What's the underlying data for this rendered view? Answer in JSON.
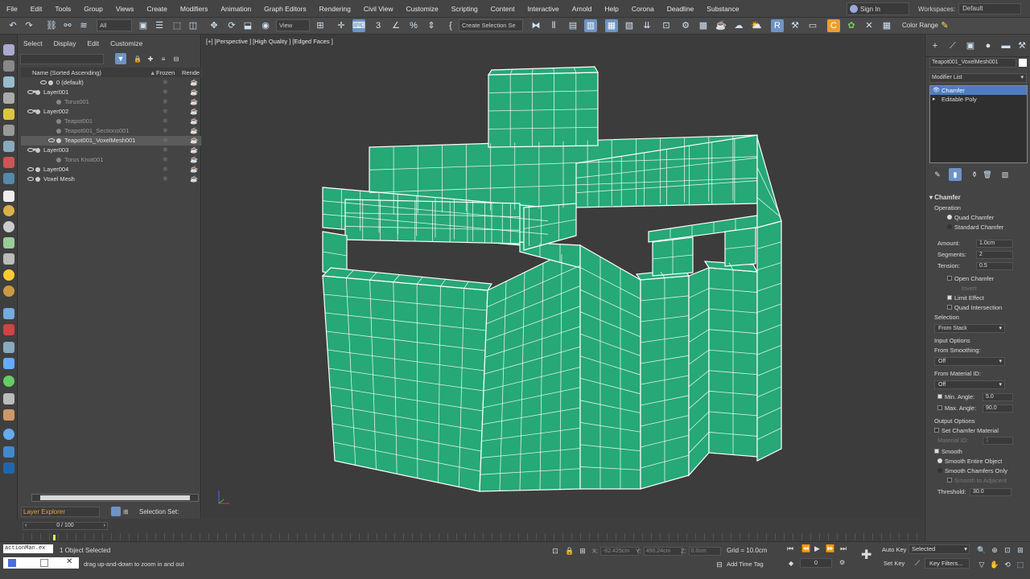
{
  "menu": [
    "File",
    "Edit",
    "Tools",
    "Group",
    "Views",
    "Create",
    "Modifiers",
    "Animation",
    "Graph Editors",
    "Rendering",
    "Civil View",
    "Customize",
    "Scripting",
    "Content",
    "Interactive",
    "Arnold",
    "Help",
    "Corona",
    "Deadline",
    "Substance"
  ],
  "sign_in": "Sign In",
  "workspace_label": "Workspaces:",
  "workspace_value": "Default",
  "toolbar": {
    "filter_value": "All",
    "ref_coord": "View",
    "selection_set": "Create Selection Se",
    "color_range": "Color Range"
  },
  "scene_explorer": {
    "tabs": [
      "Select",
      "Display",
      "Edit",
      "Customize"
    ],
    "col_name": "Name (Sorted Ascending)",
    "col_frozen": "Frozen",
    "col_render": "Rende",
    "rows": [
      {
        "label": "0 (default)",
        "dim": false,
        "sel": false
      },
      {
        "label": "Layer001",
        "dim": false,
        "sel": false
      },
      {
        "label": "Torus001",
        "dim": true,
        "sel": false
      },
      {
        "label": "Layer002",
        "dim": false,
        "sel": false
      },
      {
        "label": "Teapot001",
        "dim": true,
        "sel": false
      },
      {
        "label": "Teapot001_Sections001",
        "dim": true,
        "sel": false
      },
      {
        "label": "Teapot001_VoxelMesh001",
        "dim": false,
        "sel": true
      },
      {
        "label": "Layer003",
        "dim": false,
        "sel": false
      },
      {
        "label": "Torus Knot001",
        "dim": true,
        "sel": false
      },
      {
        "label": "Layer004",
        "dim": false,
        "sel": false
      },
      {
        "label": "Voxel Mesh",
        "dim": false,
        "sel": false
      }
    ],
    "bottom_title": "Layer Explorer",
    "selection_set_label": "Selection Set:"
  },
  "viewport": {
    "label": "[+] [Perspective ] [High Quality ] [Edged Faces ]",
    "mesh_color": "#26a877",
    "wire_color": "#ffffff"
  },
  "command_panel": {
    "object_name": "Teapot001_VoxelMesh001",
    "modifier_list": "Modifier List",
    "stack": [
      "Chamfer",
      "Editable Poly"
    ],
    "rollout_title": "Chamfer",
    "operation_label": "Operation",
    "quad_chamfer": "Quad Chamfer",
    "standard_chamfer": "Standard Chamfer",
    "amount_label": "Amount:",
    "amount_value": "1.0cm",
    "segments_label": "Segments:",
    "segments_value": "2",
    "tension_label": "Tension:",
    "tension_value": "0.5",
    "open_chamfer": "Open Chamfer",
    "invert": "Invert",
    "limit_effect": "Limit Effect",
    "quad_intersection": "Quad Intersection",
    "selection_label": "Selection",
    "selection_value": "From Stack",
    "input_options": "Input Options",
    "from_smoothing": "From Smoothing:",
    "from_smoothing_value": "Off",
    "from_material": "From Material ID:",
    "from_material_value": "Off",
    "min_angle_label": "Min. Angle:",
    "min_angle_value": "5.0",
    "max_angle_label": "Max. Angle:",
    "max_angle_value": "90.0",
    "output_options": "Output Options",
    "set_chamfer_material": "Set Chamfer Material",
    "material_id": "Material ID:",
    "material_id_value": "1",
    "smooth": "Smooth",
    "smooth_entire": "Smooth Entire Object",
    "smooth_chamfers": "Smooth Chamfers Only",
    "smooth_adjacent": "Smooth to Adjacent",
    "threshold_label": "Threshold:",
    "threshold_value": "30.0"
  },
  "timeline": {
    "frame": "0 / 100"
  },
  "status": {
    "maxscript": "actionMan.ex",
    "selected": "1 Object Selected",
    "prompt": "drag up-and-down to zoom in and out",
    "x_label": "X:",
    "x_value": "-62.425cm",
    "y_label": "Y:",
    "y_value": "490.24cm",
    "z_label": "Z:",
    "z_value": "0.0cm",
    "grid": "Grid = 10.0cm",
    "add_time_tag": "Add Time Tag",
    "auto_key": "Auto Key",
    "set_key": "Set Key",
    "selected_dropdown": "Selected",
    "key_filters": "Key Filters...",
    "frame_value": "0"
  }
}
